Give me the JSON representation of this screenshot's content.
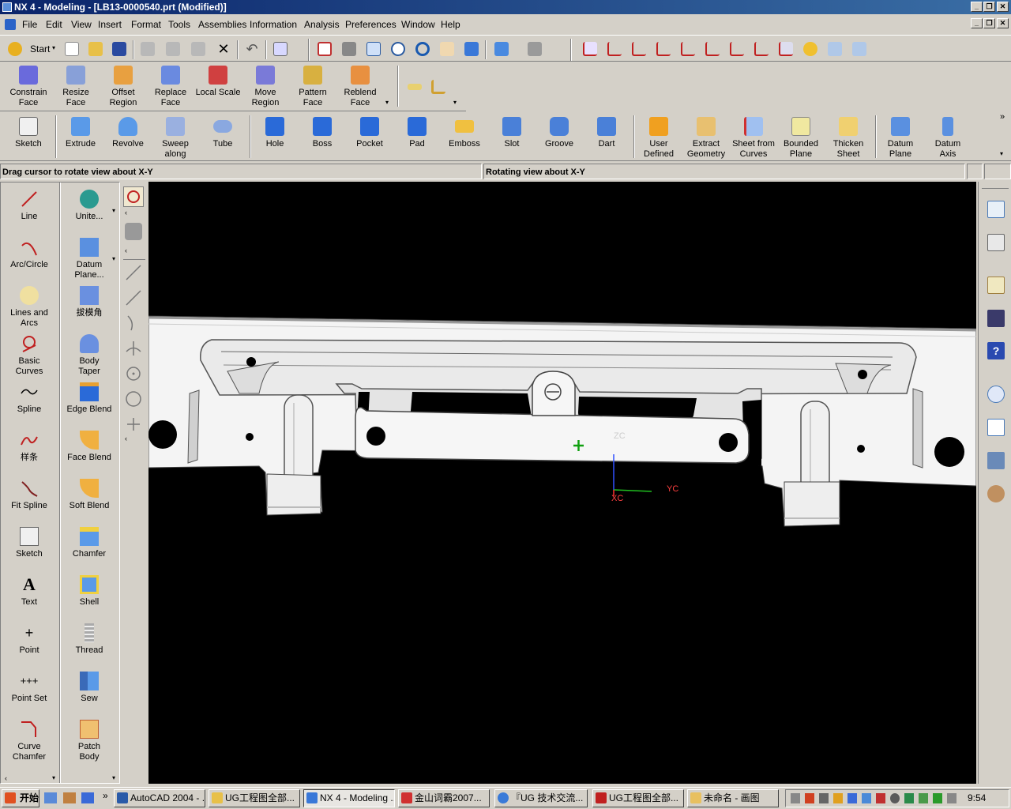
{
  "window": {
    "title": "NX 4 - Modeling - [LB13-0000540.prt (Modified)]"
  },
  "menu": [
    "File",
    "Edit",
    "View",
    "Insert",
    "Format",
    "Tools",
    "Assemblies",
    "Information",
    "Analysis",
    "Preferences",
    "Window",
    "Help"
  ],
  "toolbar_std": {
    "start_label": "Start"
  },
  "feature_ops": [
    {
      "l1": "Constrain",
      "l2": "Face"
    },
    {
      "l1": "Resize",
      "l2": "Face"
    },
    {
      "l1": "Offset",
      "l2": "Region"
    },
    {
      "l1": "Replace",
      "l2": "Face"
    },
    {
      "l1": "Local Scale",
      "l2": ""
    },
    {
      "l1": "Move",
      "l2": "Region"
    },
    {
      "l1": "Pattern",
      "l2": "Face"
    },
    {
      "l1": "Reblend",
      "l2": "Face"
    }
  ],
  "form_features": [
    {
      "l1": "Sketch",
      "l2": ""
    },
    {
      "l1": "Extrude",
      "l2": ""
    },
    {
      "l1": "Revolve",
      "l2": ""
    },
    {
      "l1": "Sweep",
      "l2": "along"
    },
    {
      "l1": "Tube",
      "l2": ""
    },
    {
      "l1": "Hole",
      "l2": ""
    },
    {
      "l1": "Boss",
      "l2": ""
    },
    {
      "l1": "Pocket",
      "l2": ""
    },
    {
      "l1": "Pad",
      "l2": ""
    },
    {
      "l1": "Emboss",
      "l2": ""
    },
    {
      "l1": "Slot",
      "l2": ""
    },
    {
      "l1": "Groove",
      "l2": ""
    },
    {
      "l1": "Dart",
      "l2": ""
    },
    {
      "l1": "User",
      "l2": "Defined"
    },
    {
      "l1": "Extract",
      "l2": "Geometry"
    },
    {
      "l1": "Sheet from",
      "l2": "Curves"
    },
    {
      "l1": "Bounded",
      "l2": "Plane"
    },
    {
      "l1": "Thicken",
      "l2": "Sheet"
    },
    {
      "l1": "Datum",
      "l2": "Plane"
    },
    {
      "l1": "Datum",
      "l2": "Axis"
    }
  ],
  "status": {
    "prompt": "Drag cursor to rotate view about X-Y",
    "message": "Rotating view about X-Y"
  },
  "palette_left": [
    {
      "l1": "Line",
      "l2": ""
    },
    {
      "l1": "Arc/Circle",
      "l2": ""
    },
    {
      "l1": "Lines and",
      "l2": "Arcs"
    },
    {
      "l1": "Basic",
      "l2": "Curves"
    },
    {
      "l1": "Spline",
      "l2": ""
    },
    {
      "l1": "样条",
      "l2": ""
    },
    {
      "l1": "Fit Spline",
      "l2": ""
    },
    {
      "l1": "Sketch",
      "l2": ""
    },
    {
      "l1": "Text",
      "l2": ""
    },
    {
      "l1": "Point",
      "l2": ""
    },
    {
      "l1": "Point Set",
      "l2": ""
    },
    {
      "l1": "Curve",
      "l2": "Chamfer"
    }
  ],
  "palette_right": [
    {
      "l1": "Unite...",
      "l2": ""
    },
    {
      "l1": "Datum",
      "l2": "Plane..."
    },
    {
      "l1": "拔模角",
      "l2": ""
    },
    {
      "l1": "Body",
      "l2": "Taper"
    },
    {
      "l1": "Edge Blend",
      "l2": ""
    },
    {
      "l1": "Face Blend",
      "l2": ""
    },
    {
      "l1": "Soft Blend",
      "l2": ""
    },
    {
      "l1": "Chamfer",
      "l2": ""
    },
    {
      "l1": "Shell",
      "l2": ""
    },
    {
      "l1": "Thread",
      "l2": ""
    },
    {
      "l1": "Sew",
      "l2": ""
    },
    {
      "l1": "Patch",
      "l2": "Body"
    }
  ],
  "axes": {
    "zc": "ZC",
    "yc": "YC",
    "xc": "XC"
  },
  "taskbar": {
    "start": "开始",
    "tasks": [
      "AutoCAD 2004 - ...",
      "UG工程图全部...",
      "NX 4 - Modeling ...",
      "金山词霸2007...",
      "『UG 技术交流...",
      "UG工程图全部...",
      "未命名 - 画图"
    ],
    "clock": "9:54"
  },
  "colors": {
    "titlebar": "#0a246a",
    "viewport_bg": "#000000",
    "chrome": "#d4d0c8"
  }
}
